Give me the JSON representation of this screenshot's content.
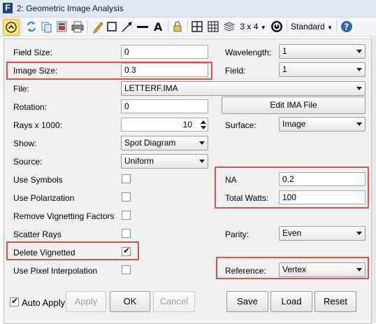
{
  "window": {
    "title": "2: Geometric Image Analysis",
    "app_icon_letter": "F"
  },
  "toolbar": {
    "layout_label": "3 x 4",
    "style_label": "Standard"
  },
  "form": {
    "field_size": {
      "label": "Field Size:",
      "value": "0"
    },
    "image_size": {
      "label": "Image Size:",
      "value": "0.3"
    },
    "file": {
      "label": "File:",
      "value": "LETTERF.IMA"
    },
    "rotation": {
      "label": "Rotation:",
      "value": "0"
    },
    "rays": {
      "label": "Rays x 1000:",
      "value": "10"
    },
    "show": {
      "label": "Show:",
      "value": "Spot Diagram"
    },
    "source": {
      "label": "Source:",
      "value": "Uniform"
    },
    "use_symbols": {
      "label": "Use Symbols",
      "checked": false
    },
    "use_polarization": {
      "label": "Use Polarization",
      "checked": false
    },
    "remove_vignetting": {
      "label": "Remove Vignetting Factors",
      "checked": false
    },
    "scatter_rays": {
      "label": "Scatter Rays",
      "checked": false
    },
    "delete_vignetted": {
      "label": "Delete Vignetted",
      "checked": true
    },
    "pixel_interpolation": {
      "label": "Use Pixel Interpolation",
      "checked": false
    },
    "wavelength": {
      "label": "Wavelength:",
      "value": "1"
    },
    "field": {
      "label": "Field:",
      "value": "1"
    },
    "edit_ima_button": "Edit IMA File",
    "surface": {
      "label": "Surface:",
      "value": "Image"
    },
    "na": {
      "label": "NA",
      "value": "0.2"
    },
    "total_watts": {
      "label": "Total Watts:",
      "value": "100"
    },
    "parity": {
      "label": "Parity:",
      "value": "Even"
    },
    "reference": {
      "label": "Reference:",
      "value": "Vertex"
    }
  },
  "buttons": {
    "auto_apply": {
      "label": "Auto Apply",
      "checked": true
    },
    "apply": "Apply",
    "ok": "OK",
    "cancel": "Cancel",
    "save": "Save",
    "load": "Load",
    "reset": "Reset"
  },
  "colors": {
    "highlight": "#d9534f",
    "title_bg": "#dfe8f4",
    "selected_tool": "#fbe47a"
  }
}
